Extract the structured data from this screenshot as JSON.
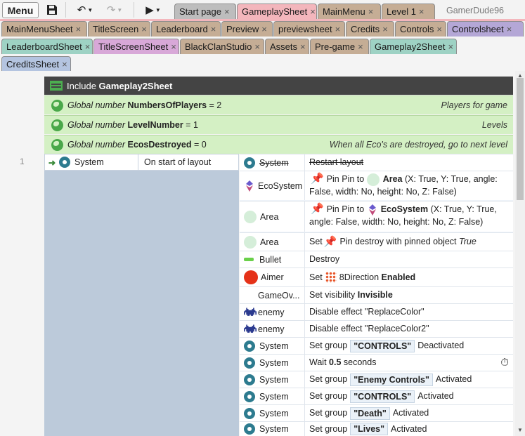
{
  "toolbar": {
    "menu_label": "Menu",
    "user": "GamerDude96"
  },
  "tabs_row1": [
    {
      "label": "Start page",
      "color": "#bdbdbd"
    },
    {
      "label": "GameplaySheet",
      "color": "#f3b6bc",
      "active": true
    },
    {
      "label": "MainMenu",
      "color": "#c5ad95"
    },
    {
      "label": "Level 1",
      "color": "#c5ad95"
    }
  ],
  "tabs_row2": [
    {
      "label": "MainMenuSheet",
      "color": "#c5ad95"
    },
    {
      "label": "TitleScreen",
      "color": "#c5ad95"
    },
    {
      "label": "Leaderboard",
      "color": "#c5ad95"
    },
    {
      "label": "Preview",
      "color": "#c5ad95"
    },
    {
      "label": "previewsheet",
      "color": "#c5ad95"
    },
    {
      "label": "Credits",
      "color": "#c5ad95"
    },
    {
      "label": "Controls",
      "color": "#c5ad95"
    },
    {
      "label": "Controlsheet",
      "color": "#b4a7d6"
    }
  ],
  "tabs_row3": [
    {
      "label": "LeaderboardSheet",
      "color": "#9ed2c4"
    },
    {
      "label": "TitleScreenSheet",
      "color": "#d8a8d8"
    },
    {
      "label": "BlackClanStudio",
      "color": "#c5ad95"
    },
    {
      "label": "Assets",
      "color": "#c5ad95"
    },
    {
      "label": "Pre-game",
      "color": "#c5ad95"
    },
    {
      "label": "Gameplay2Sheet",
      "color": "#9ed2c4"
    }
  ],
  "tabs_row4": [
    {
      "label": "CreditsSheet",
      "color": "#b4c4e0"
    }
  ],
  "include": {
    "prefix": "Include",
    "sheet": "Gameplay2Sheet"
  },
  "globals": [
    {
      "prefix": "Global number",
      "name": "NumbersOfPlayers",
      "value": "= 2",
      "comment": "Players for game"
    },
    {
      "prefix": "Global number",
      "name": "LevelNumber",
      "value": "= 1",
      "comment": "Levels"
    },
    {
      "prefix": "Global number",
      "name": "EcosDestroyed",
      "value": "= 0",
      "comment": "When all Eco's are destroyed, go to next level"
    }
  ],
  "event": {
    "number": "1",
    "object": "System",
    "condition": "On start of layout"
  },
  "actions": [
    {
      "object": "System",
      "text": "Restart layout"
    },
    {
      "object": "EcoSystem",
      "pin_prefix": "Pin Pin to",
      "target": "Area",
      "params": "(X: True, Y: True, angle: False, width: No, height: No, Z: False)"
    },
    {
      "object": "Area",
      "pin_prefix": "Pin Pin to",
      "target": "EcoSystem",
      "params": "(X: True, Y: True, angle: False, width: No, height: No, Z: False)"
    },
    {
      "object": "Area",
      "set": "Set",
      "behavior": "Pin destroy with pinned object",
      "value": "True"
    },
    {
      "object": "Bullet",
      "text": "Destroy"
    },
    {
      "object": "Aimer",
      "set": "Set",
      "behavior": "8Direction",
      "value": "Enabled"
    },
    {
      "object": "GameOv...",
      "text": "Set visibility",
      "value": "Invisible"
    },
    {
      "object": "enemy",
      "text": "Disable effect \"ReplaceColor\""
    },
    {
      "object": "enemy",
      "text": "Disable effect \"ReplaceColor2\""
    },
    {
      "object": "System",
      "prefix": "Set group",
      "group": "\"CONTROLS\"",
      "state": "Deactivated"
    },
    {
      "object": "System",
      "prefix": "Wait",
      "value": "0.5",
      "suffix": "seconds"
    },
    {
      "object": "System",
      "prefix": "Set group",
      "group": "\"Enemy Controls\"",
      "state": "Activated"
    },
    {
      "object": "System",
      "prefix": "Set group",
      "group": "\"CONTROLS\"",
      "state": "Activated"
    },
    {
      "object": "System",
      "prefix": "Set group",
      "group": "\"Death\"",
      "state": "Activated"
    },
    {
      "object": "System",
      "prefix": "Set group",
      "group": "\"Lives\"",
      "state": "Activated"
    }
  ]
}
